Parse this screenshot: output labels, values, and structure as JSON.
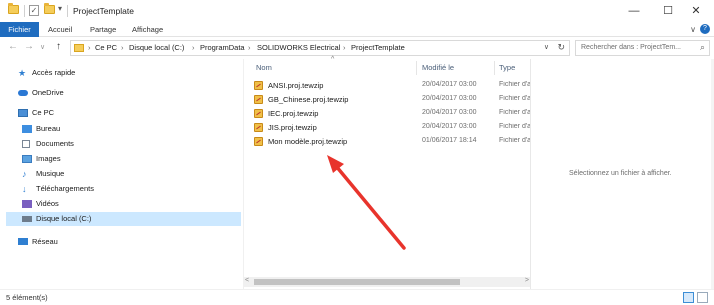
{
  "window": {
    "title": "ProjectTemplate",
    "controls": {
      "minimize": "—",
      "maximize": "☐",
      "close": "✕"
    }
  },
  "quick_access": {
    "pin_glyph": "▾"
  },
  "ribbon": {
    "tabs": [
      "Fichier",
      "Accueil",
      "Partage",
      "Affichage"
    ],
    "expand_glyph": "∨",
    "help_glyph": "?"
  },
  "nav_buttons": {
    "back": "←",
    "forward": "→",
    "recent": "∨",
    "up": "↑"
  },
  "address": {
    "crumbs": [
      "Ce PC",
      "Disque local (C:)",
      "ProgramData",
      "SOLIDWORKS Electrical",
      "ProjectTemplate"
    ],
    "separator": "›",
    "dropdown_glyph": "∨",
    "refresh_glyph": "↻"
  },
  "search": {
    "placeholder": "Rechercher dans : ProjectTem...",
    "icon": "search-icon"
  },
  "sidebar": {
    "items": [
      {
        "label": "Accès rapide",
        "icon": "star-icon",
        "color": "#2f7fd1"
      },
      {
        "label": "OneDrive",
        "icon": "cloud-icon",
        "color": "#2a78d4"
      },
      {
        "label": "Ce PC",
        "icon": "pc-icon",
        "color": "#4a8fd6"
      },
      {
        "label": "Bureau",
        "icon": "desktop-folder-icon",
        "color": "#3d8ee0"
      },
      {
        "label": "Documents",
        "icon": "documents-icon",
        "color": "#7a8796"
      },
      {
        "label": "Images",
        "icon": "images-icon",
        "color": "#5ba2e0"
      },
      {
        "label": "Musique",
        "icon": "music-icon",
        "color": "#2f7fd1"
      },
      {
        "label": "Téléchargements",
        "icon": "download-icon",
        "color": "#2f7fd1"
      },
      {
        "label": "Vidéos",
        "icon": "videos-icon",
        "color": "#7a5fc0"
      },
      {
        "label": "Disque local (C:)",
        "icon": "drive-icon",
        "color": "#6d7c8c",
        "selected": true
      },
      {
        "label": "Réseau",
        "icon": "network-icon",
        "color": "#2f7fd1"
      }
    ]
  },
  "file_list": {
    "columns": [
      "Nom",
      "Modifié le",
      "Type"
    ],
    "sort_glyph": "^",
    "rows": [
      {
        "name": "ANSI.proj.tewzip",
        "modified": "20/04/2017 03:00",
        "type": "Fichier d'a"
      },
      {
        "name": "GB_Chinese.proj.tewzip",
        "modified": "20/04/2017 03:00",
        "type": "Fichier d'a"
      },
      {
        "name": "IEC.proj.tewzip",
        "modified": "20/04/2017 03:00",
        "type": "Fichier d'a"
      },
      {
        "name": "JIS.proj.tewzip",
        "modified": "20/04/2017 03:00",
        "type": "Fichier d'a"
      },
      {
        "name": "Mon modèle.proj.tewzip",
        "modified": "01/06/2017 18:14",
        "type": "Fichier d'a"
      }
    ],
    "scroll": {
      "left": "<",
      "right": ">"
    }
  },
  "preview": {
    "message": "Sélectionnez un fichier à afficher."
  },
  "status": {
    "count": "5 élément(s)"
  },
  "annotation": {
    "arrow_color": "#e8342c"
  }
}
